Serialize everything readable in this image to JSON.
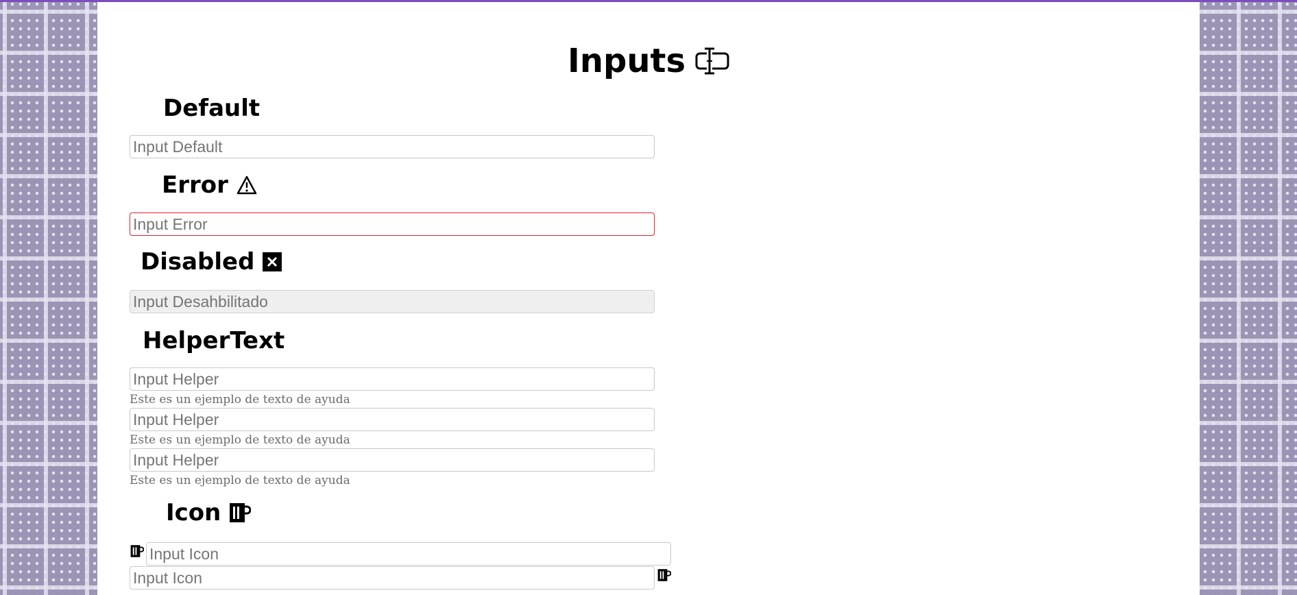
{
  "page": {
    "title": "Inputs"
  },
  "sections": {
    "default": {
      "title": "Default",
      "placeholder": "Input Default"
    },
    "error": {
      "title": "Error",
      "placeholder": "Input Error"
    },
    "disabled": {
      "title": "Disabled",
      "placeholder": "Input Desahbilitado"
    },
    "helper": {
      "title": "HelperText",
      "fields": [
        {
          "placeholder": "Input Helper",
          "helper": "Este es un ejemplo de texto de ayuda"
        },
        {
          "placeholder": "Input Helper",
          "helper": "Este es un ejemplo de texto de ayuda"
        },
        {
          "placeholder": "Input Helper",
          "helper": "Este es un ejemplo de texto de ayuda"
        }
      ]
    },
    "icon": {
      "title": "Icon",
      "fields": [
        {
          "placeholder": "Input Icon",
          "icon": "mug-icon",
          "icon_position": "left"
        },
        {
          "placeholder": "Input Icon",
          "icon": "mug-icon",
          "icon_position": "right"
        }
      ]
    }
  },
  "colors": {
    "accent": "#7c4dbf",
    "error": "#e0202a",
    "disabled_bg": "#efefef",
    "pattern": "#9c94b4"
  }
}
